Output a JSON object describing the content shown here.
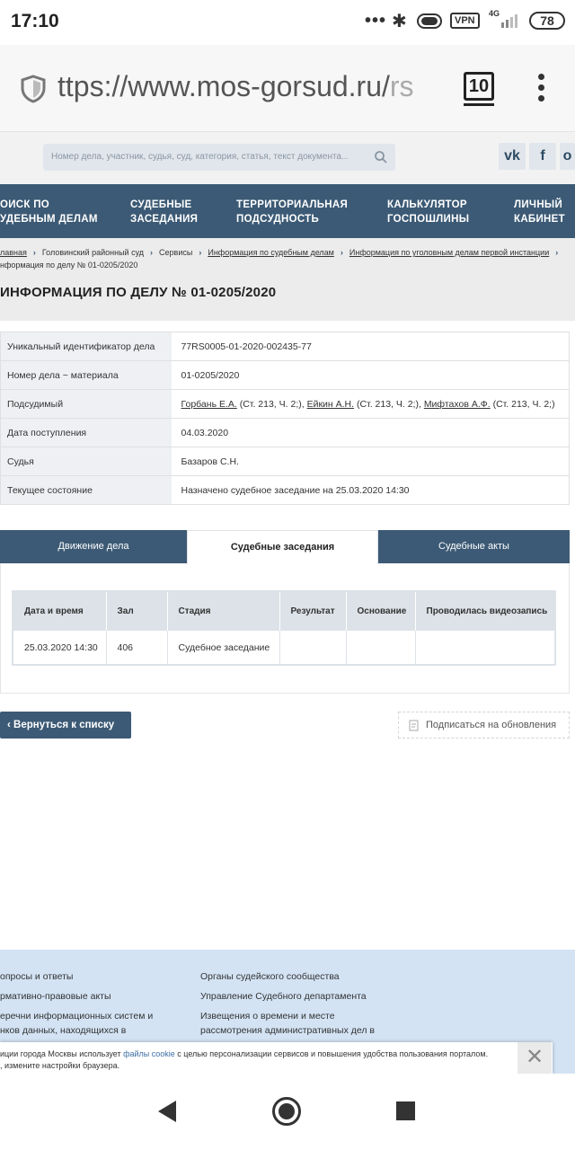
{
  "status_bar": {
    "time": "17:10",
    "dots": "•••",
    "bluetooth_icon": "bluetooth-icon",
    "vpn": "VPN",
    "network": "4G",
    "battery": "78"
  },
  "browser": {
    "url_main": "ttps://www.mos-gorsud.ru/",
    "url_faded": "rs",
    "tab_count": "10"
  },
  "site_header": {
    "search_placeholder": "Номер дела, участник, судья, суд, категория, статья, текст документа...",
    "social": [
      "vk",
      "f",
      "o"
    ]
  },
  "main_nav": [
    "ОИСК ПО\nУДЕБНЫМ ДЕЛАМ",
    "СУДЕБНЫЕ\nЗАСЕДАНИЯ",
    "ТЕРРИТОРИАЛЬНАЯ\nПОДСУДНОСТЬ",
    "КАЛЬКУЛЯТОР\nГОСПОШЛИНЫ",
    "ЛИЧНЫЙ\nКАБИНЕТ"
  ],
  "breadcrumb": {
    "items": [
      "лавная",
      "Головинский районный суд",
      "Сервисы",
      "Информация по судебным делам",
      "Информация по уголовным делам первой инстанции"
    ],
    "current": "нформация по делу № 01-0205/2020"
  },
  "page_title": "ИНФОРМАЦИЯ ПО ДЕЛУ № 01-0205/2020",
  "case_info": {
    "uid_label": "Уникальный идентификатор дела",
    "uid_value": "77RS0005-01-2020-002435-77",
    "number_label": "Номер дела ~ материала",
    "number_value": "01-0205/2020",
    "defendant_label": "Подсудимый",
    "d1_name": "Горбань Е.А.",
    "d1_art": " (Ст. 213, Ч. 2;), ",
    "d2_name": "Ейкин А.Н.",
    "d2_art": " (Ст. 213, Ч. 2;), ",
    "d3_name": "Мифтахов А.Ф.",
    "d3_art": " (Ст. 213, Ч. 2;)",
    "date_label": "Дата поступления",
    "date_value": "04.03.2020",
    "judge_label": "Судья",
    "judge_value": "Базаров С.Н.",
    "state_label": "Текущее состояние",
    "state_value": "Назначено судебное заседание на 25.03.2020 14:30"
  },
  "tabs": {
    "movement": "Движение дела",
    "hearings": "Судебные заседания",
    "acts": "Судебные акты",
    "active": "hearings"
  },
  "hearings_table": {
    "columns": [
      "Дата и время",
      "Зал",
      "Стадия",
      "Результат",
      "Основание",
      "Проводилась видеозапись"
    ],
    "rows": [
      [
        "25.03.2020 14:30",
        "406",
        "Судебное заседание",
        "",
        "",
        ""
      ]
    ]
  },
  "actions": {
    "back": "Вернуться к списку",
    "subscribe": "Подписаться на обновления"
  },
  "footer": {
    "col1": [
      "опросы и ответы",
      "рмативно-правовые акты",
      "еречни информационных систем и\nнков данных, находящихся в"
    ],
    "col2": [
      "Органы судейского сообщества",
      "Управление Судебного департамента",
      "Извещения о времени и месте\nрассмотрения административных дел в"
    ]
  },
  "cookie": {
    "text_before": "иции города Москвы использует ",
    "link": "файлы cookie",
    "text_after": " с целью персонализации сервисов и повышения удобства пользования порталом.",
    "line2": ", измените настройки браузера."
  },
  "colors": {
    "nav": "#3c5a75",
    "footer": "#d3e3f4",
    "table_key": "#eef0f3"
  }
}
